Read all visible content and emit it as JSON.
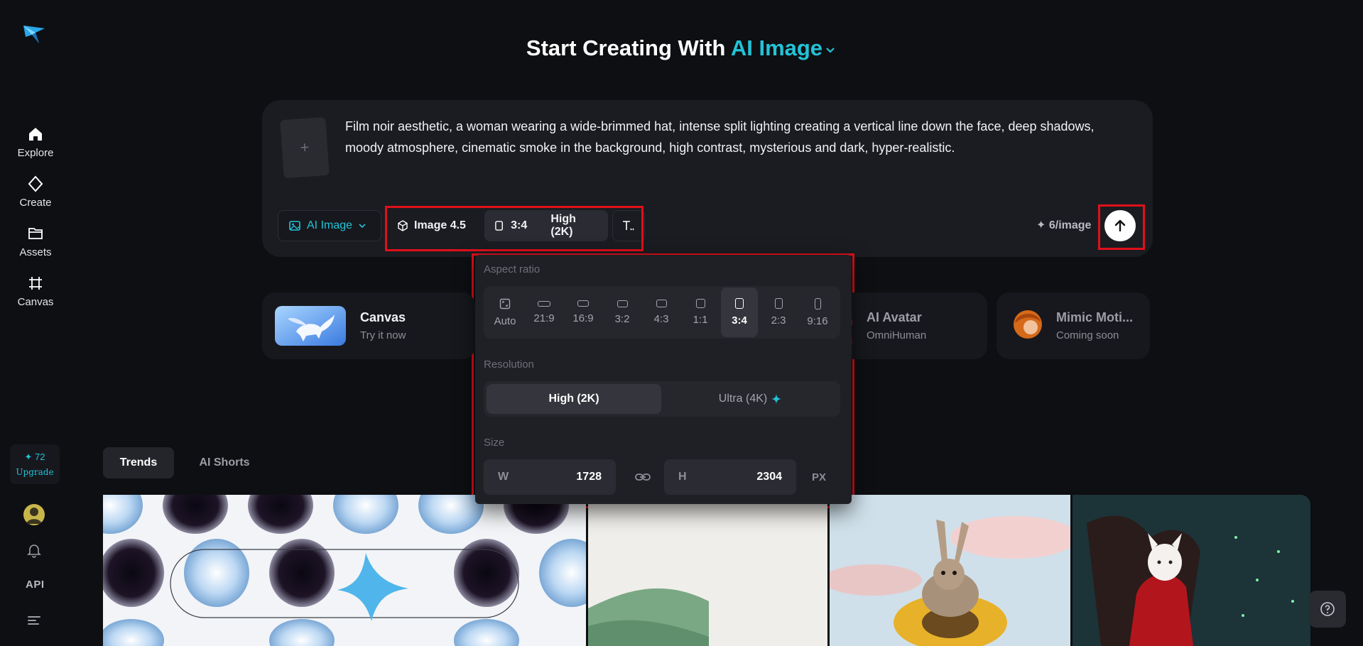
{
  "sidebar": {
    "nav": [
      {
        "label": "Explore",
        "icon": "home-icon"
      },
      {
        "label": "Create",
        "icon": "diamond-icon"
      },
      {
        "label": "Assets",
        "icon": "folder-icon"
      },
      {
        "label": "Canvas",
        "icon": "frame-icon"
      }
    ],
    "credits": "✦ 72",
    "upgrade_label": "Upgrade",
    "api_label": "API"
  },
  "header": {
    "title_prefix": "Start Creating With",
    "title_accent": "AI Image"
  },
  "prompt": {
    "upload_placeholder": "+",
    "text": "Film noir aesthetic, a woman wearing a wide-brimmed hat, intense split lighting creating a vertical line down the face, deep shadows, moody atmosphere, cinematic smoke in the background, high contrast, mysterious and dark, hyper-realistic.",
    "mode_label": "AI Image",
    "model_label": "Image 4.5",
    "ratio_value": "3:4",
    "resolution_value": "High (2K)",
    "cost_label": "✦ 6/image"
  },
  "features": [
    {
      "title": "Canvas",
      "subtitle": "Try it now"
    },
    {
      "title": "AI Avatar",
      "subtitle": "OmniHuman"
    },
    {
      "title": "Mimic Moti...",
      "subtitle": "Coming soon"
    }
  ],
  "tabs": [
    {
      "label": "Trends",
      "active": true
    },
    {
      "label": "AI Shorts",
      "active": false
    }
  ],
  "popover": {
    "aspect_label": "Aspect ratio",
    "ratios": [
      "Auto",
      "21:9",
      "16:9",
      "3:2",
      "4:3",
      "1:1",
      "3:4",
      "2:3",
      "9:16"
    ],
    "selected_ratio": "3:4",
    "resolution_label": "Resolution",
    "resolutions": [
      "High (2K)",
      "Ultra (4K)"
    ],
    "size_label": "Size",
    "width_label": "W",
    "width_value": "1728",
    "height_label": "H",
    "height_value": "2304",
    "unit": "PX"
  },
  "colors": {
    "accent": "#22c3d8",
    "highlight": "#e0101a",
    "background": "#0e0f12"
  }
}
